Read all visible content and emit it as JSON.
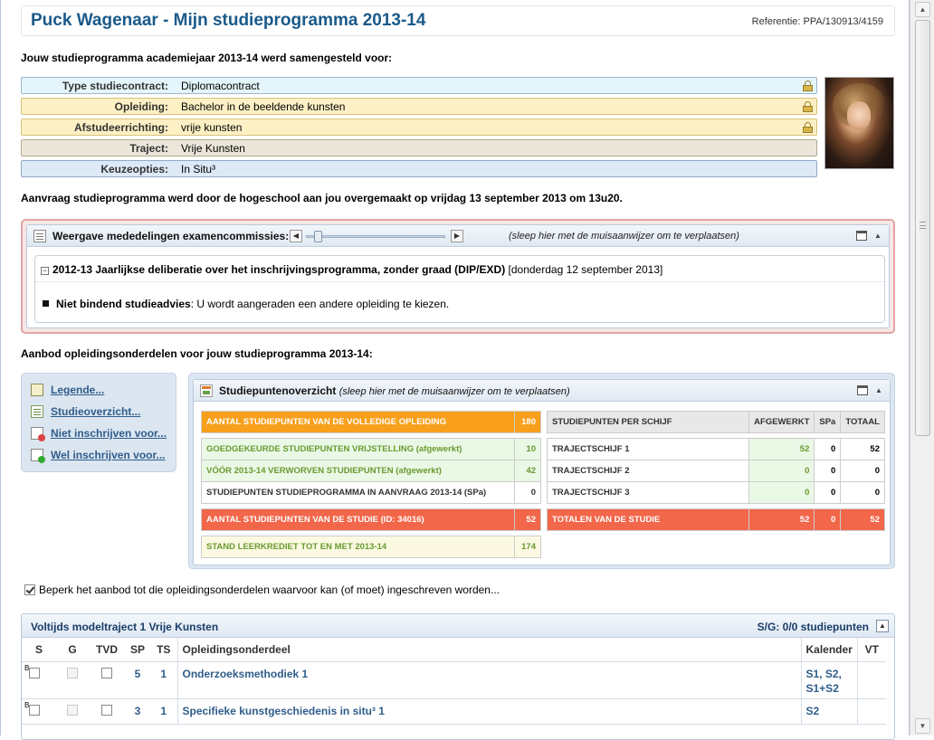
{
  "header": {
    "title": "Puck Wagenaar - Mijn studieprogramma 2013-14",
    "reference": "Referentie: PPA/130913/4159"
  },
  "intro": "Jouw studieprogramma academiejaar 2013-14 werd samengesteld voor:",
  "info_rows": [
    {
      "label": "Type studiecontract:",
      "value": "Diplomacontract",
      "bg": "#e4f6fb",
      "locked": true
    },
    {
      "label": "Opleiding:",
      "value": "Bachelor in de beeldende kunsten",
      "bg": "#fdf0c4",
      "locked": true
    },
    {
      "label": "Afstudeerrichting:",
      "value": "vrije kunsten",
      "bg": "#fdf0c4",
      "locked": true
    },
    {
      "label": "Traject:",
      "value": "Vrije Kunsten",
      "bg": "#ece6da",
      "locked": false
    },
    {
      "label": "Keuzeopties:",
      "value": "In Situ³",
      "bg": "#dde9f7",
      "locked": false
    }
  ],
  "request_line": "Aanvraag studieprogramma werd door de hogeschool aan jou overgemaakt op vrijdag 13 september 2013 om 13u20.",
  "notices_panel": {
    "title": "Weergave mededelingen examencommissies:",
    "hint": "(sleep hier met de muisaanwijzer om te verplaatsen)",
    "zoom_slider": 0.05,
    "notice_title": "2012-13 Jaarlijkse deliberatie over het inschrijvingsprogramma, zonder graad (DIP/EXD)",
    "notice_date": "[donderdag 12 september 2013]",
    "advice_label": "Niet bindend studieadvies",
    "advice_text": ": U wordt aangeraden een andere opleiding te kiezen."
  },
  "offer_line": "Aanbod opleidingsonderdelen voor jouw studieprogramma 2013-14:",
  "side_links": [
    {
      "label": "Legende...",
      "icon": "legend-icon"
    },
    {
      "label": "Studieoverzicht...",
      "icon": "study-overview-icon"
    },
    {
      "label": "Niet inschrijven voor...",
      "icon": "do-not-enroll-icon"
    },
    {
      "label": "Wel inschrijven voor...",
      "icon": "do-enroll-icon"
    }
  ],
  "credits_panel": {
    "title": "Studiepuntenoverzicht",
    "hint": "(sleep hier met de muisaanwijzer om te verplaatsen)",
    "left_rows": [
      {
        "label": "AANTAL STUDIEPUNTEN VAN DE VOLLEDIGE OPLEIDING",
        "value": "180",
        "style": "orange"
      },
      {
        "label": "GOEDGEKEURDE STUDIEPUNTEN VRIJSTELLING (afgewerkt)",
        "value": "10",
        "style": "green"
      },
      {
        "label": "VÓÓR 2013-14 VERWORVEN STUDIEPUNTEN (afgewerkt)",
        "value": "42",
        "style": "green"
      },
      {
        "label": "STUDIEPUNTEN STUDIEPROGRAMMA IN AANVRAAG 2013-14 (SPa)",
        "value": "0",
        "style": "plain"
      },
      {
        "label": "AANTAL STUDIEPUNTEN VAN DE STUDIE (ID: 34016)",
        "value": "52",
        "style": "red"
      },
      {
        "label": "STAND LEERKREDIET TOT EN MET 2013-14",
        "value": "174",
        "style": "yellow"
      }
    ],
    "right_headers": [
      "STUDIEPUNTEN PER SCHIJF",
      "AFGEWERKT",
      "SPa",
      "TOTAAL"
    ],
    "right_rows": [
      {
        "label": "TRAJECTSCHIJF 1",
        "afgewerkt": "52",
        "spa": "0",
        "totaal": "52"
      },
      {
        "label": "TRAJECTSCHIJF 2",
        "afgewerkt": "0",
        "spa": "0",
        "totaal": "0"
      },
      {
        "label": "TRAJECTSCHIJF 3",
        "afgewerkt": "0",
        "spa": "0",
        "totaal": "0"
      }
    ],
    "totals": {
      "label": "TOTALEN VAN DE STUDIE",
      "afgewerkt": "52",
      "spa": "0",
      "totaal": "52"
    }
  },
  "filter_checkbox": {
    "label": "Beperk het aanbod tot die opleidingsonderdelen waarvoor kan (of moet) ingeschreven worden...",
    "checked": true
  },
  "trajectory": {
    "title": "Voltijds modeltraject 1 Vrije Kunsten",
    "sg": "S/G: 0/0 studiepunten",
    "columns": [
      "S",
      "G",
      "TVD",
      "SP",
      "TS",
      "Opleidingsonderdeel",
      "Kalender",
      "VT"
    ],
    "rows": [
      {
        "marker": "B",
        "sp": "5",
        "ts": "1",
        "name": "Onderzoeksmethodiek 1",
        "kalender": [
          "S1, S2,",
          "S1+S2"
        ]
      },
      {
        "marker": "B",
        "sp": "3",
        "ts": "1",
        "name": "Specifieke kunstgeschiedenis in situ³ 1",
        "kalender": [
          "S2"
        ]
      }
    ]
  },
  "colors": {
    "title_blue": "#1a5a8a",
    "link_blue": "#2f5d8a",
    "orange": "#f8a01c",
    "red": "#f2664a",
    "green_text": "#6a9a30"
  }
}
